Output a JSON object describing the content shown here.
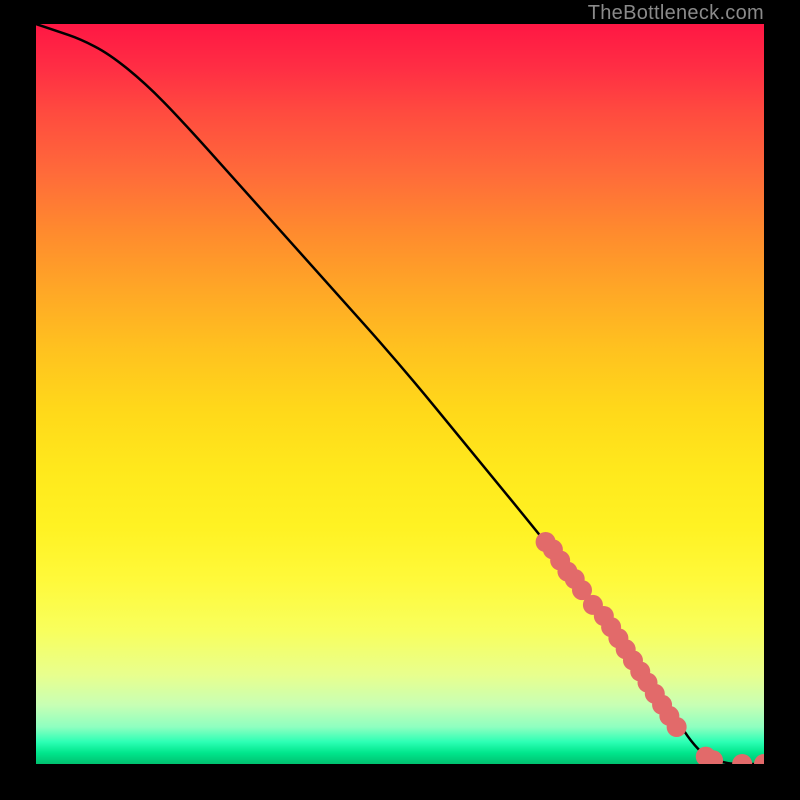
{
  "attribution": "TheBottleneck.com",
  "chart_data": {
    "type": "line",
    "title": "",
    "xlabel": "",
    "ylabel": "",
    "xlim": [
      0,
      100
    ],
    "ylim": [
      0,
      100
    ],
    "series": [
      {
        "name": "curve",
        "x": [
          0,
          3,
          6,
          10,
          15,
          20,
          30,
          40,
          50,
          60,
          70,
          78,
          84,
          88,
          90,
          92,
          95,
          98,
          100
        ],
        "y": [
          100,
          99,
          98,
          96,
          92,
          87,
          76,
          65,
          54,
          42,
          30,
          20,
          12,
          6,
          3,
          1,
          0,
          0,
          0
        ]
      }
    ],
    "markers": {
      "name": "dots",
      "color": "#e26a6a",
      "radius": 10,
      "x": [
        70,
        71,
        72,
        73,
        74,
        75,
        76.5,
        78,
        79,
        80,
        81,
        82,
        83,
        84,
        85,
        86,
        87,
        88,
        92,
        93,
        97,
        100
      ],
      "y": [
        30,
        29,
        27.5,
        26,
        25,
        23.5,
        21.5,
        20,
        18.5,
        17,
        15.5,
        14,
        12.5,
        11,
        9.5,
        8,
        6.5,
        5,
        1,
        0.5,
        0,
        0
      ]
    }
  }
}
